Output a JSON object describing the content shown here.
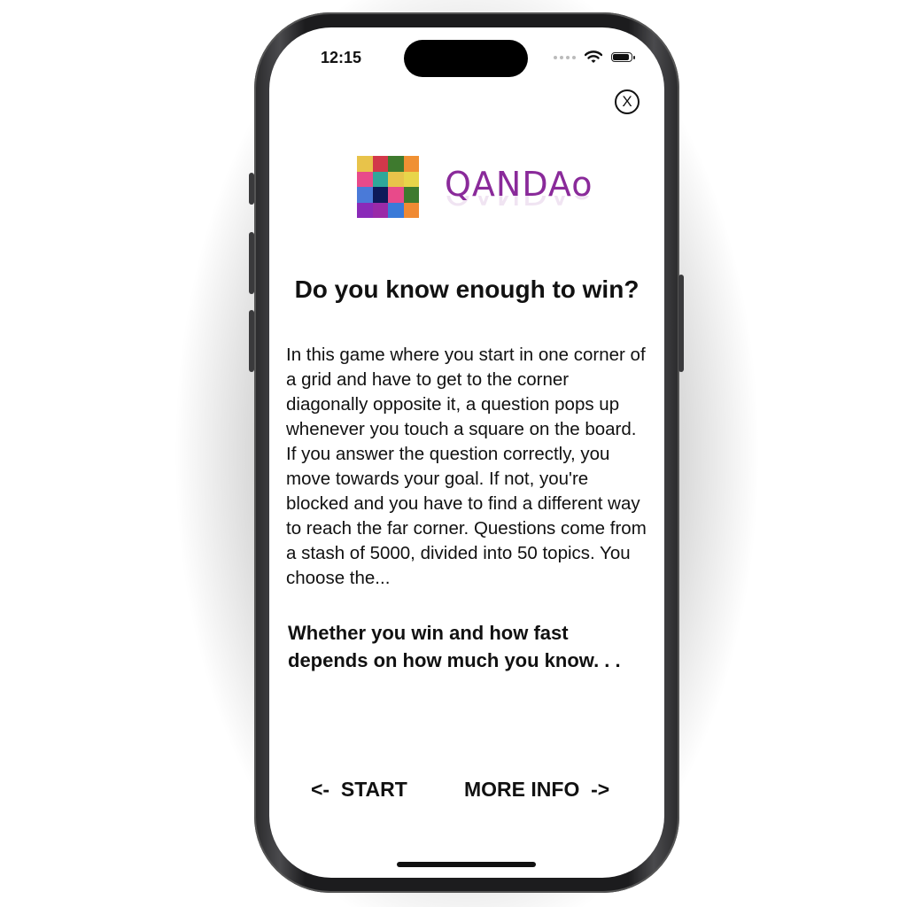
{
  "status_bar": {
    "time": "12:15",
    "icons": [
      "signal-dots-icon",
      "wifi-icon",
      "battery-icon"
    ]
  },
  "close_button": {
    "label": "X"
  },
  "logo": {
    "text": "QANDAo",
    "text_color": "#8a2a9a",
    "grid_colors": [
      "#e8c34a",
      "#d2384a",
      "#3e7a2e",
      "#f09033",
      "#e84a8a",
      "#2fa79a",
      "#e8c34a",
      "#e8d54a",
      "#4a7ad8",
      "#0e1a5a",
      "#e84a8a",
      "#3e7a2e",
      "#8a2ab8",
      "#9a2aa8",
      "#3a7ad8",
      "#f08a33"
    ]
  },
  "headline": "Do you know enough to win?",
  "body": "In this game where you start in one corner of a grid and have to get to the corner diagonally opposite it, a question pops up whenever you touch a square on the board. If you answer the question correctly, you move towards your goal.  If not, you're blocked and you have to find a different way to reach the far corner. Questions come from a stash of 5000, divided into 50 topics.  You choose the...",
  "tagline": "Whether you win and how fast depends on how much you know. . .",
  "nav": {
    "start_label": "<-  START",
    "more_info_label": "MORE INFO  ->"
  }
}
